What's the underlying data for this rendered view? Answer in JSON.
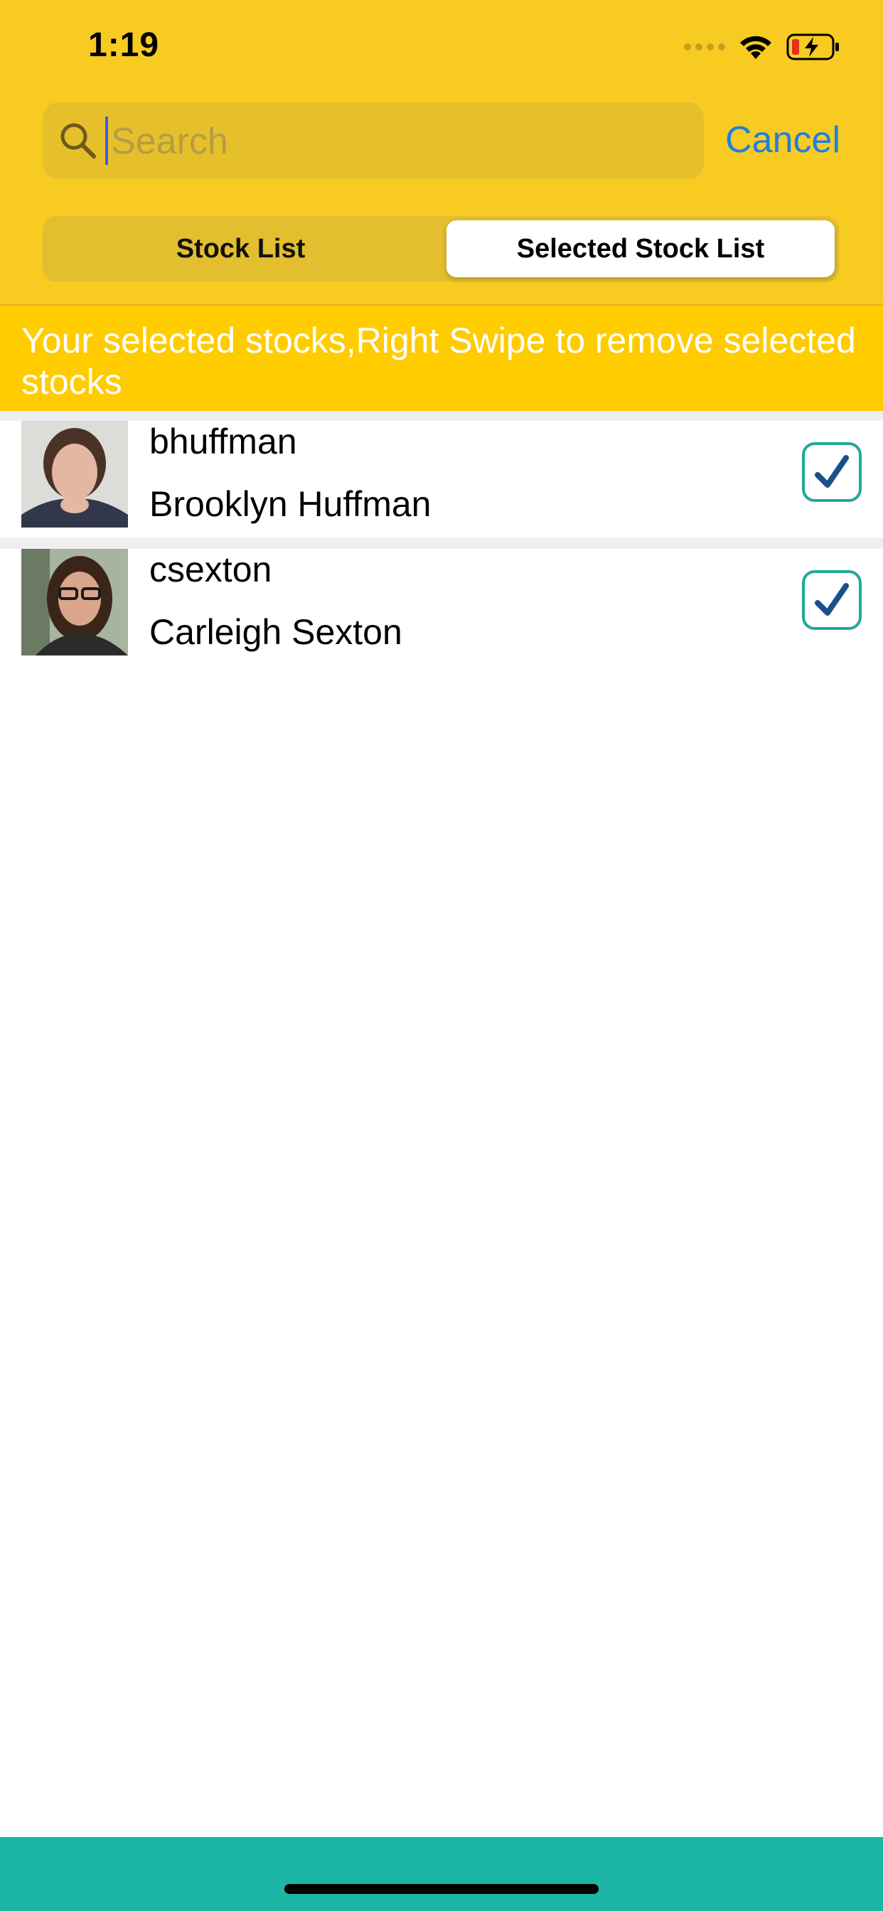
{
  "status_bar": {
    "time": "1:19",
    "icons": [
      "signal-dots-icon",
      "wifi-icon",
      "battery-charging-icon"
    ]
  },
  "search": {
    "placeholder": "Search",
    "value": "",
    "icon": "search-icon",
    "cancel_label": "Cancel"
  },
  "segments": [
    {
      "label": "Stock List",
      "selected": false
    },
    {
      "label": "Selected Stock List",
      "selected": true
    }
  ],
  "banner": {
    "text": "Your selected stocks,Right Swipe to remove selected stocks"
  },
  "stocks": [
    {
      "username": "bhuffman",
      "name": "Brooklyn Huffman",
      "checked": true,
      "avatar": "avatar-photo"
    },
    {
      "username": "csexton",
      "name": "Carleigh Sexton",
      "checked": true,
      "avatar": "avatar-photo"
    }
  ],
  "colors": {
    "header": "#f7cb22",
    "banner": "#ffcc00",
    "accent_blue": "#1f7fe0",
    "checkbox_border": "#21a89a",
    "check_mark": "#1c4e8c",
    "bottom_bar": "#1db5a5"
  }
}
